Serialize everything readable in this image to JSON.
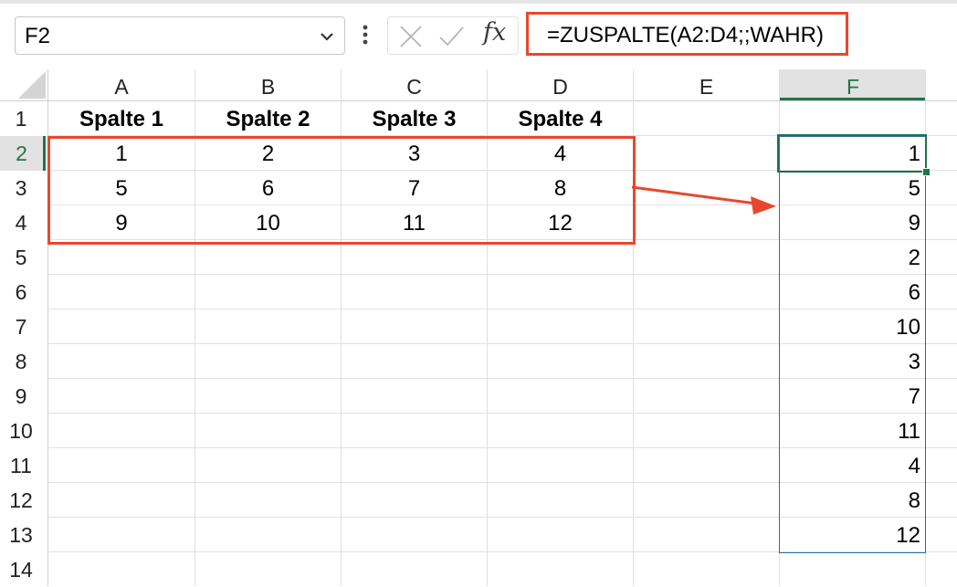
{
  "namebox": {
    "value": "F2"
  },
  "formula": {
    "text": "=ZUSPALTE(A2:D4;;WAHR)",
    "fx_label": "fx"
  },
  "columns": [
    "A",
    "B",
    "C",
    "D",
    "E",
    "F"
  ],
  "rows": [
    "1",
    "2",
    "3",
    "4",
    "5",
    "6",
    "7",
    "8",
    "9",
    "10",
    "11",
    "12",
    "13",
    "14"
  ],
  "headers": [
    "Spalte 1",
    "Spalte 2",
    "Spalte 3",
    "Spalte 4"
  ],
  "source_data": [
    [
      "1",
      "2",
      "3",
      "4"
    ],
    [
      "5",
      "6",
      "7",
      "8"
    ],
    [
      "9",
      "10",
      "11",
      "12"
    ]
  ],
  "result_column": [
    "1",
    "5",
    "9",
    "2",
    "6",
    "10",
    "3",
    "7",
    "11",
    "4",
    "8",
    "12"
  ],
  "colors": {
    "highlight": "#e8472c",
    "selection": "#217346",
    "spill": "#2b6cb0"
  },
  "icons": [
    "chevron-down-icon",
    "more-options-icon",
    "cancel-icon",
    "enter-icon",
    "insert-function-icon",
    "select-all-icon",
    "arrow-icon"
  ]
}
